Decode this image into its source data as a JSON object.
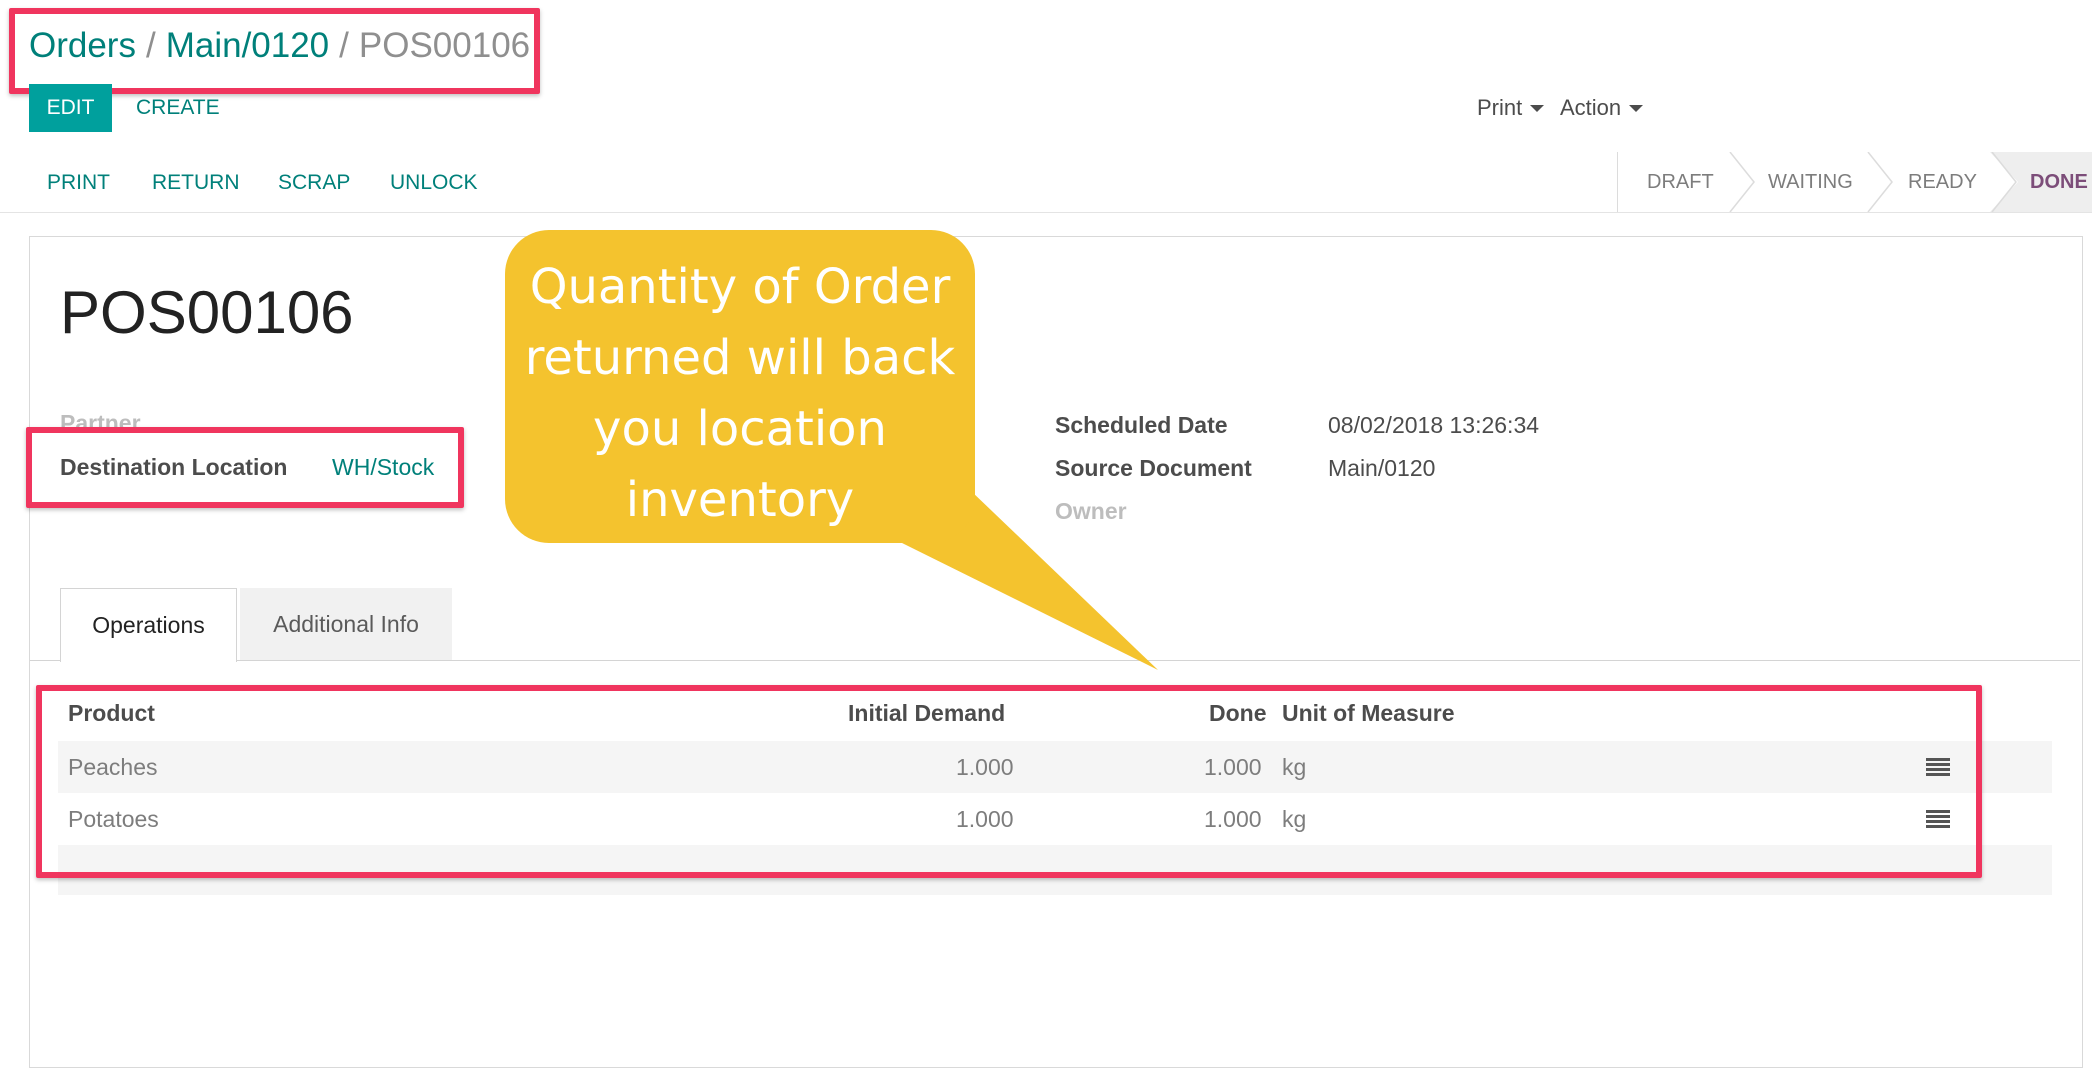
{
  "breadcrumb": {
    "items": [
      "Orders",
      "Main/0120",
      "POS00106"
    ],
    "separator": "/"
  },
  "control_panel": {
    "edit_label": "EDIT",
    "create_label": "CREATE",
    "print_label": "Print",
    "action_label": "Action"
  },
  "header_buttons": {
    "print": "PRINT",
    "return": "RETURN",
    "scrap": "SCRAP",
    "unlock": "UNLOCK"
  },
  "status": {
    "stages": [
      "DRAFT",
      "WAITING",
      "READY",
      "DONE"
    ],
    "current": "DONE"
  },
  "record": {
    "name": "POS00106",
    "fields_left": {
      "partner_label": "Partner",
      "destination_label": "Destination Location",
      "destination_value": "WH/Stock"
    },
    "fields_right": {
      "scheduled_date_label": "Scheduled Date",
      "scheduled_date_value": "08/02/2018 13:26:34",
      "source_document_label": "Source Document",
      "source_document_value": "Main/0120",
      "owner_label": "Owner"
    }
  },
  "tabs": {
    "operations": "Operations",
    "additional_info": "Additional Info"
  },
  "table": {
    "headers": {
      "product": "Product",
      "initial_demand": "Initial Demand",
      "done": "Done",
      "uom": "Unit of Measure"
    },
    "rows": [
      {
        "product": "Peaches",
        "initial_demand": "1.000",
        "done": "1.000",
        "uom": "kg"
      },
      {
        "product": "Potatoes",
        "initial_demand": "1.000",
        "done": "1.000",
        "uom": "kg"
      }
    ]
  },
  "callout": {
    "lines": [
      "Quantity of Order",
      "returned will back",
      "you location",
      "inventory"
    ]
  },
  "colors": {
    "accent": "#00a09d",
    "link": "#00807a",
    "highlight": "#f0355e",
    "callout": "#f4c32e",
    "done_stage": "#7c4d79"
  }
}
